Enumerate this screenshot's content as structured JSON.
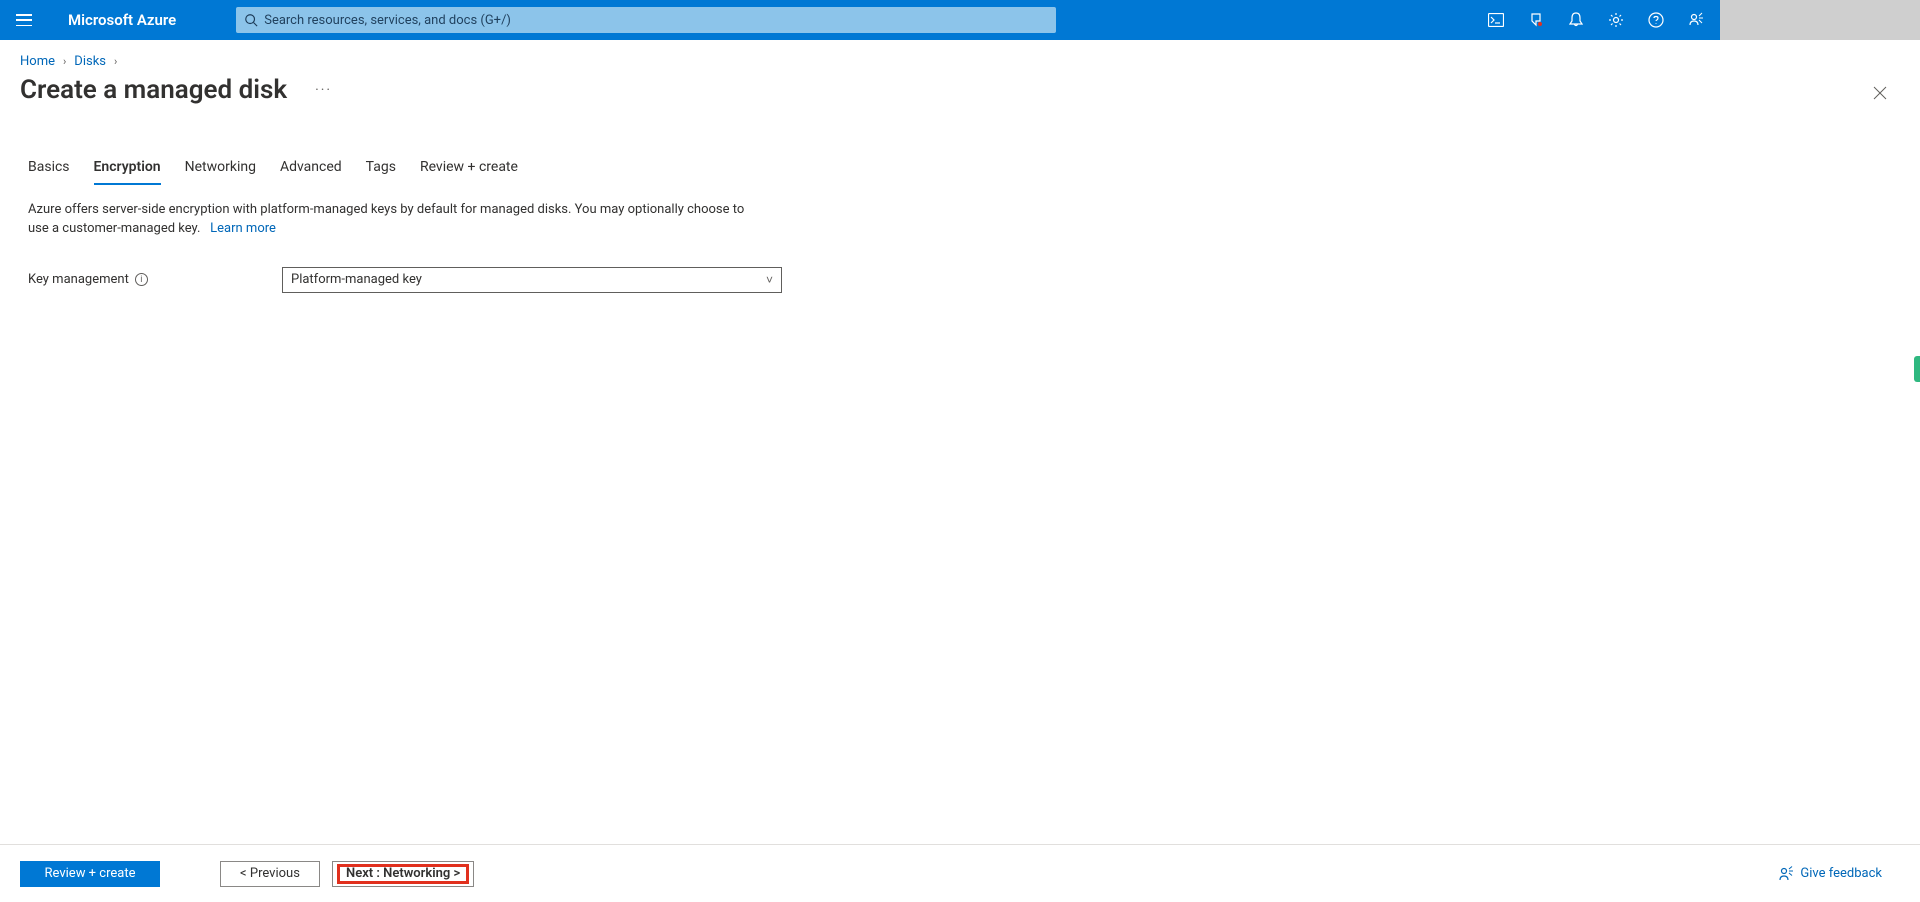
{
  "header": {
    "brand": "Microsoft Azure",
    "search_placeholder": "Search resources, services, and docs (G+/)"
  },
  "breadcrumb": {
    "home": "Home",
    "disks": "Disks"
  },
  "page": {
    "title": "Create a managed disk",
    "more": "···"
  },
  "tabs": {
    "basics": "Basics",
    "encryption": "Encryption",
    "networking": "Networking",
    "advanced": "Advanced",
    "tags": "Tags",
    "review": "Review + create"
  },
  "desc": {
    "text": "Azure offers server-side encryption with platform-managed keys by default for managed disks. You may optionally choose to use a customer-managed key.",
    "learn_more": "Learn more"
  },
  "form": {
    "key_mgmt_label": "Key management",
    "key_mgmt_value": "Platform-managed key"
  },
  "footer": {
    "review": "Review + create",
    "previous": "< Previous",
    "next": "Next : Networking >",
    "feedback": "Give feedback"
  }
}
